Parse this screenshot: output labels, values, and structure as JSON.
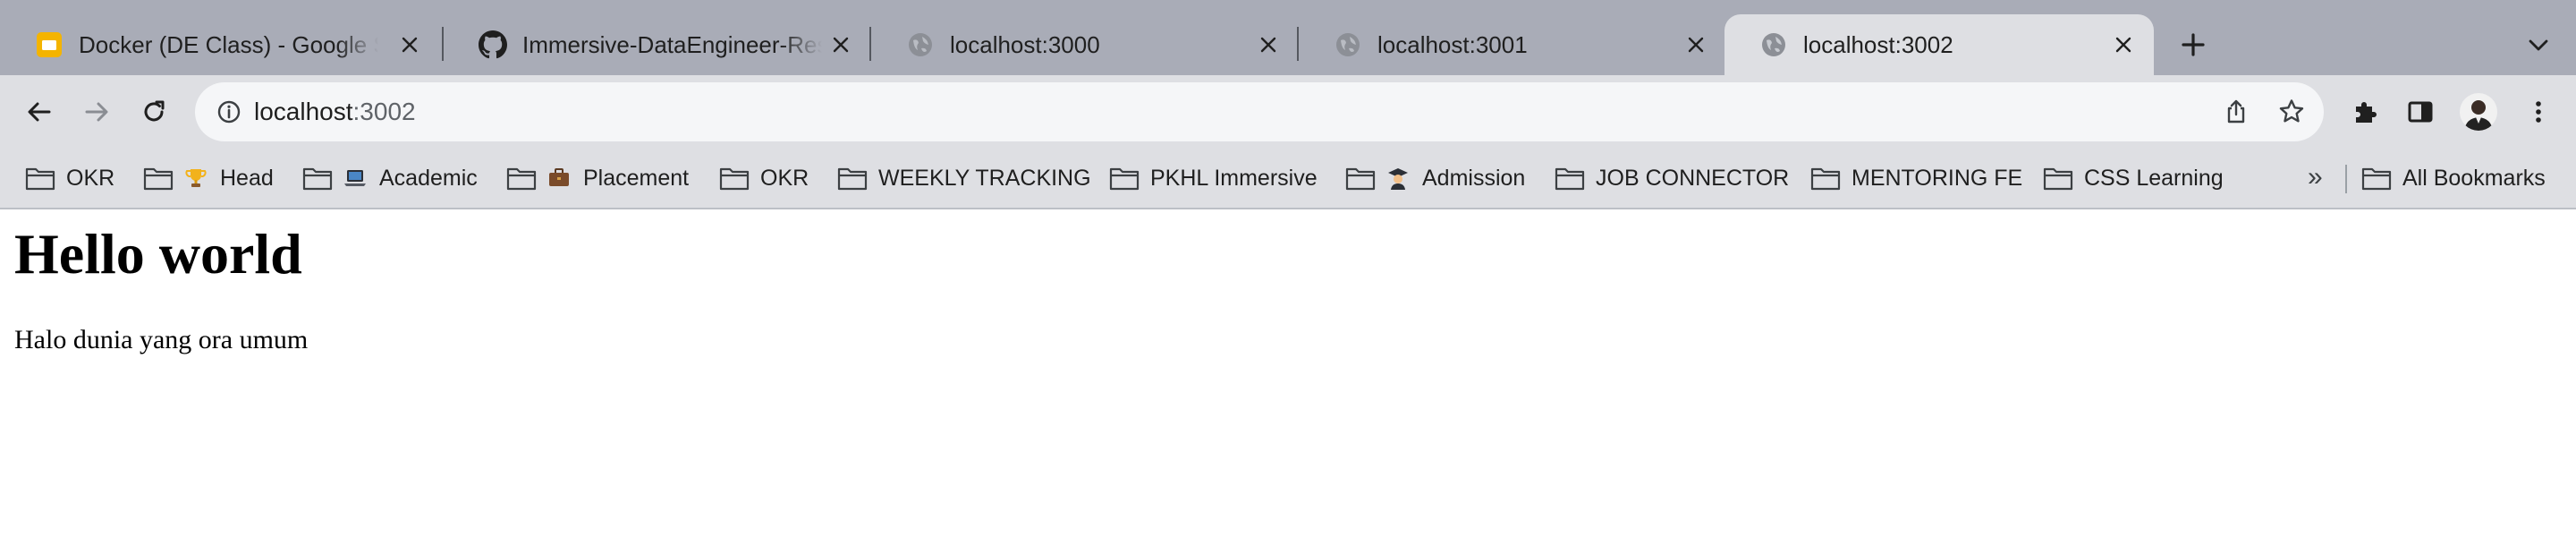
{
  "tabs": [
    {
      "title": "Docker (DE Class) - Google Slides",
      "favicon": "google-slides-icon",
      "active": false
    },
    {
      "title": "Immersive-DataEngineer-Resources",
      "favicon": "github-icon",
      "active": false
    },
    {
      "title": "localhost:3000",
      "favicon": "globe-icon",
      "active": false
    },
    {
      "title": "localhost:3001",
      "favicon": "globe-icon",
      "active": false
    },
    {
      "title": "localhost:3002",
      "favicon": "globe-icon",
      "active": true
    }
  ],
  "toolbar": {
    "back_icon": "arrow-left-icon",
    "forward_icon": "arrow-right-icon",
    "reload_icon": "reload-icon",
    "info_icon": "info-icon",
    "url_host": "localhost",
    "url_port": ":3002",
    "share_icon": "share-icon",
    "bookmark_star_icon": "star-icon",
    "extensions_icon": "puzzle-icon",
    "side_panel_icon": "side-panel-icon",
    "menu_icon": "kebab-menu-icon"
  },
  "bookmarks": [
    {
      "label": "OKR"
    },
    {
      "label": "Head",
      "emoji_icon": "trophy-icon"
    },
    {
      "label": "Academic",
      "emoji_icon": "laptop-icon"
    },
    {
      "label": "Placement",
      "emoji_icon": "briefcase-icon"
    },
    {
      "label": "OKR"
    },
    {
      "label": "WEEKLY TRACKING"
    },
    {
      "label": "PKHL Immersive"
    },
    {
      "label": "Admission",
      "emoji_icon": "graduate-icon"
    },
    {
      "label": "JOB CONNECTOR"
    },
    {
      "label": "MENTORING FE"
    },
    {
      "label": "CSS Learning"
    }
  ],
  "bookmarks_overflow": "»",
  "all_bookmarks": "All Bookmarks",
  "page": {
    "heading": "Hello world",
    "paragraph": "Halo dunia yang ora umum"
  },
  "colors": {
    "tabstrip": "#a9acb7",
    "toolbar": "#dedfe3",
    "omnibox": "#f5f6f8",
    "slides_yellow": "#f4b400"
  }
}
